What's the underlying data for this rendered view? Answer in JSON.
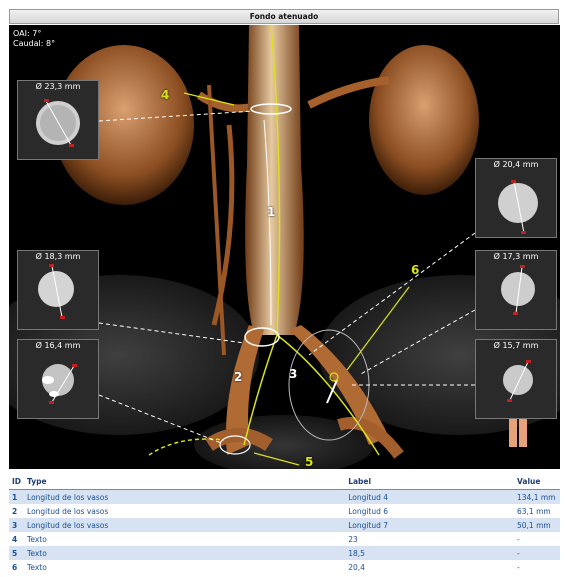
{
  "window": {
    "title": "Fondo atenuado"
  },
  "viewport": {
    "orientation": [
      "OAI: 7°",
      "Caudal: 8°"
    ],
    "labels": [
      "1",
      "2",
      "3",
      "4",
      "5",
      "6"
    ],
    "colors": {
      "measure_line": "#d9e21a",
      "highlight": "#ffffff",
      "vessel": "#b8703a",
      "background": "#000000"
    }
  },
  "thumbnails": [
    {
      "diameter": "Ø 23,3 mm"
    },
    {
      "diameter": "Ø 18,3 mm"
    },
    {
      "diameter": "Ø 16,4 mm"
    },
    {
      "diameter": "Ø 20,4 mm"
    },
    {
      "diameter": "Ø 17,3 mm"
    },
    {
      "diameter": "Ø 15,7 mm"
    }
  ],
  "table": {
    "headers": {
      "id": "ID",
      "type": "Type",
      "label": "Label",
      "value": "Value"
    },
    "rows": [
      {
        "id": "1",
        "type": "Longitud de los vasos",
        "label": "Longitud 4",
        "value": "134,1 mm"
      },
      {
        "id": "2",
        "type": "Longitud de los vasos",
        "label": "Longitud 6",
        "value": "63,1 mm"
      },
      {
        "id": "3",
        "type": "Longitud de los vasos",
        "label": "Longitud 7",
        "value": "50,1 mm"
      },
      {
        "id": "4",
        "type": "Texto",
        "label": "23",
        "value": "-"
      },
      {
        "id": "5",
        "type": "Texto",
        "label": "18,5",
        "value": "-"
      },
      {
        "id": "6",
        "type": "Texto",
        "label": "20,4",
        "value": "-"
      }
    ]
  }
}
